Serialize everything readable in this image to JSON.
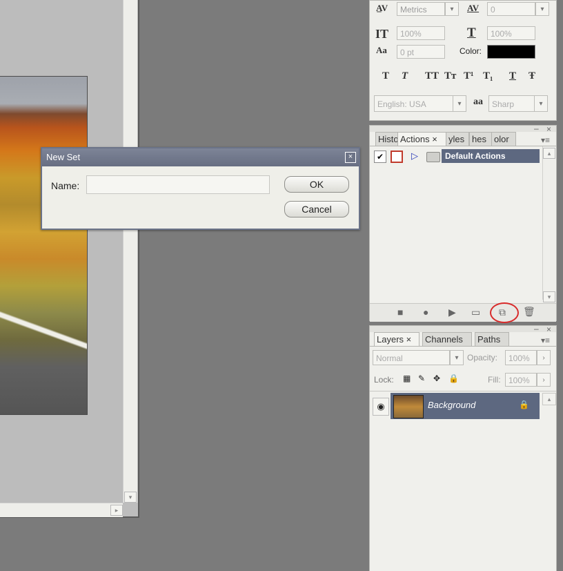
{
  "document": {
    "scroll_up": "▴",
    "scroll_down": "▾",
    "scroll_right": "▸"
  },
  "dialog": {
    "title": "New Set",
    "close": "⊠",
    "name_label": "Name:",
    "name_value": "",
    "ok_label": "OK",
    "cancel_label": "Cancel"
  },
  "character": {
    "kerning_icon": "A/V",
    "kerning_value": "Metrics",
    "tracking_icon": "AV",
    "tracking_value": "0",
    "vscale_icon": "IT",
    "vscale_value": "100%",
    "hscale_icon": "T",
    "hscale_value": "100%",
    "baseline_icon": "Aa",
    "baseline_value": "0 pt",
    "color_label": "Color:",
    "color_swatch": "#000000",
    "style_buttons": [
      "T",
      "T",
      "TT",
      "Tт",
      "T¹",
      "T₁",
      "T",
      "Ŧ"
    ],
    "language_value": "English: USA",
    "aa_icon": "aa",
    "antialias_value": "Sharp",
    "dropdown_arrow": "⌄"
  },
  "actions_panel": {
    "tabs": [
      "Histo",
      "Actions ×",
      "yles",
      "hes",
      "olor"
    ],
    "minimize": "‒",
    "close": "×",
    "menu": "▾≡",
    "check": "✔",
    "dialog_toggle": "▭",
    "expand": "▷",
    "folder": "▭",
    "action_set": "Default Actions",
    "bottom_icons": [
      "■",
      "●",
      "▶",
      "▭",
      "⧉",
      "🗑"
    ],
    "scroll_up": "▴",
    "scroll_down": "▾"
  },
  "layers_panel": {
    "tabs": [
      "Layers ×",
      "Channels",
      "Paths"
    ],
    "minimize": "‒",
    "close": "×",
    "menu": "▾≡",
    "blend_mode": "Normal",
    "opacity_label": "Opacity:",
    "opacity_value": "100%",
    "lock_label": "Lock:",
    "lock_icons": [
      "▦",
      "✎",
      "✥",
      "🔒"
    ],
    "fill_label": "Fill:",
    "fill_value": "100%",
    "arrow": "›",
    "eye": "◉",
    "layer_name": "Background",
    "layer_lock": "🔒"
  },
  "colors": {
    "highlight": "#5d6880",
    "annotation": "#d82a2a"
  }
}
